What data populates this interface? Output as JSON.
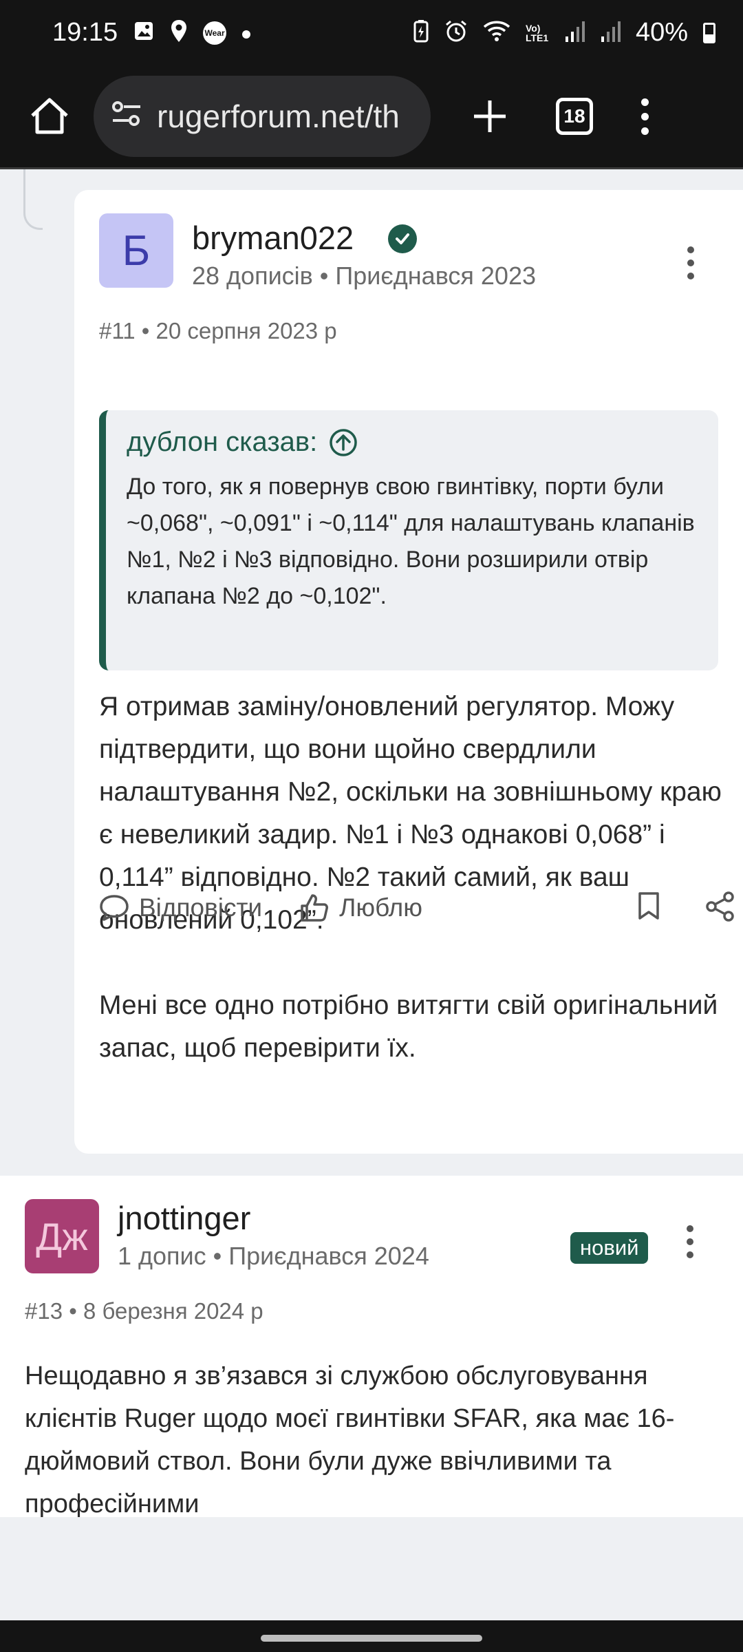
{
  "status_bar": {
    "time": "19:15",
    "battery": "40%",
    "wear_label": "Wear",
    "network_label": "Vo) LTE1"
  },
  "browser": {
    "url": "rugerforum.net/th",
    "tab_count": "18"
  },
  "post1": {
    "avatar_letter": "Б",
    "username": "bryman022",
    "meta": "28 дописів • Приєднався 2023",
    "post_number": "#11 • 20 серпня 2023 р",
    "quote": {
      "author": "дублон сказав:",
      "text": "До того, як я повернув свою гвинтівку, порти були ~0,068\", ~0,091\" і ~0,114\" для налаштувань клапанів №1, №2 і №3 відповідно. Вони розширили отвір клапана №2 до ~0,102\"."
    },
    "body_p1": "Я отримав заміну/оновлений регулятор. Можу підтвердити, що вони щойно свердлили налаштування №2, оскільки на зовнішньому краю є невеликий задир. №1 і №3 однакові 0,068” і 0,114” відповідно. №2 такий самий, як ваш оновлений 0,102”.",
    "body_p2": "Мені все одно потрібно витягти свій оригінальний запас, щоб перевірити їх.",
    "actions": {
      "reply": "Відповісти",
      "like": "Люблю"
    }
  },
  "post2": {
    "avatar_letters": "Дж",
    "username": "jnottinger",
    "meta": "1 допис • Приєднався 2024",
    "badge": "новий",
    "post_number": "#13 • 8 березня 2024 р",
    "body": "Нещодавно я зв’язався зі службою обслуговування клієнтів Ruger щодо моєї гвинтівки SFAR, яка має 16-дюймовий ствол. Вони були дуже ввічливими та професійними"
  },
  "colors": {
    "accent_green": "#1f5b4b",
    "avatar_b_bg": "#c5c5f5",
    "avatar_dz_bg": "#a83e73"
  }
}
